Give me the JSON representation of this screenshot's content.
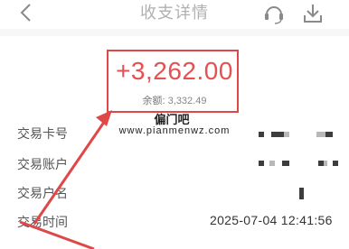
{
  "header": {
    "title": "收支详情",
    "back_icon": "back-chevron-icon",
    "service_icon": "headset-icon",
    "download_icon": "download-icon"
  },
  "summary": {
    "amount": "+3,262.00",
    "balance_label": "余额:",
    "balance_value": "3,332.49"
  },
  "watermark": {
    "title": "偏门吧",
    "url": "www.pianmenwz.com"
  },
  "details": [
    {
      "label": "交易卡号",
      "value": ""
    },
    {
      "label": "交易账户",
      "value": ""
    },
    {
      "label": "交易户名",
      "value": ""
    },
    {
      "label": "交易时间",
      "value": "2025-07-04 12:41:56"
    }
  ],
  "colors": {
    "highlight": "#e04848",
    "amount": "#e55050",
    "label": "#555555"
  }
}
